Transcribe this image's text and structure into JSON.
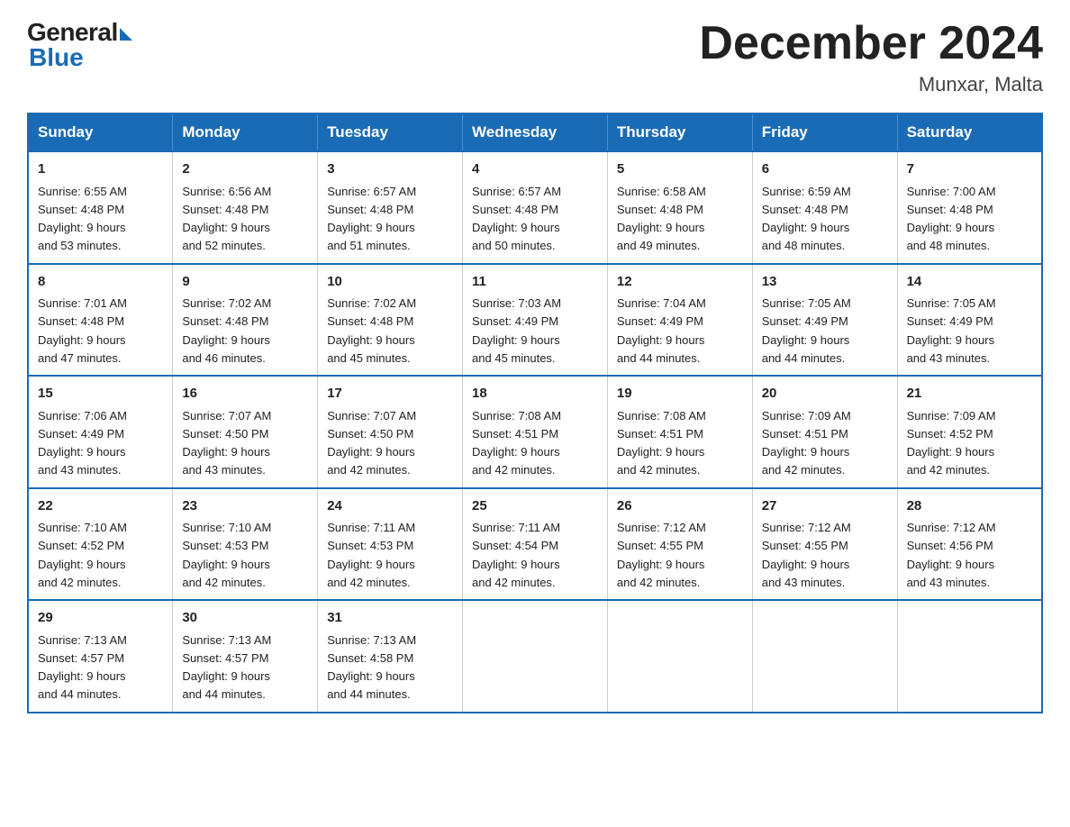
{
  "header": {
    "logo": {
      "general": "General",
      "blue": "Blue"
    },
    "title": "December 2024",
    "location": "Munxar, Malta"
  },
  "calendar": {
    "days_of_week": [
      "Sunday",
      "Monday",
      "Tuesday",
      "Wednesday",
      "Thursday",
      "Friday",
      "Saturday"
    ],
    "weeks": [
      [
        {
          "day": "1",
          "sunrise": "6:55 AM",
          "sunset": "4:48 PM",
          "daylight": "9 hours and 53 minutes."
        },
        {
          "day": "2",
          "sunrise": "6:56 AM",
          "sunset": "4:48 PM",
          "daylight": "9 hours and 52 minutes."
        },
        {
          "day": "3",
          "sunrise": "6:57 AM",
          "sunset": "4:48 PM",
          "daylight": "9 hours and 51 minutes."
        },
        {
          "day": "4",
          "sunrise": "6:57 AM",
          "sunset": "4:48 PM",
          "daylight": "9 hours and 50 minutes."
        },
        {
          "day": "5",
          "sunrise": "6:58 AM",
          "sunset": "4:48 PM",
          "daylight": "9 hours and 49 minutes."
        },
        {
          "day": "6",
          "sunrise": "6:59 AM",
          "sunset": "4:48 PM",
          "daylight": "9 hours and 48 minutes."
        },
        {
          "day": "7",
          "sunrise": "7:00 AM",
          "sunset": "4:48 PM",
          "daylight": "9 hours and 48 minutes."
        }
      ],
      [
        {
          "day": "8",
          "sunrise": "7:01 AM",
          "sunset": "4:48 PM",
          "daylight": "9 hours and 47 minutes."
        },
        {
          "day": "9",
          "sunrise": "7:02 AM",
          "sunset": "4:48 PM",
          "daylight": "9 hours and 46 minutes."
        },
        {
          "day": "10",
          "sunrise": "7:02 AM",
          "sunset": "4:48 PM",
          "daylight": "9 hours and 45 minutes."
        },
        {
          "day": "11",
          "sunrise": "7:03 AM",
          "sunset": "4:49 PM",
          "daylight": "9 hours and 45 minutes."
        },
        {
          "day": "12",
          "sunrise": "7:04 AM",
          "sunset": "4:49 PM",
          "daylight": "9 hours and 44 minutes."
        },
        {
          "day": "13",
          "sunrise": "7:05 AM",
          "sunset": "4:49 PM",
          "daylight": "9 hours and 44 minutes."
        },
        {
          "day": "14",
          "sunrise": "7:05 AM",
          "sunset": "4:49 PM",
          "daylight": "9 hours and 43 minutes."
        }
      ],
      [
        {
          "day": "15",
          "sunrise": "7:06 AM",
          "sunset": "4:49 PM",
          "daylight": "9 hours and 43 minutes."
        },
        {
          "day": "16",
          "sunrise": "7:07 AM",
          "sunset": "4:50 PM",
          "daylight": "9 hours and 43 minutes."
        },
        {
          "day": "17",
          "sunrise": "7:07 AM",
          "sunset": "4:50 PM",
          "daylight": "9 hours and 42 minutes."
        },
        {
          "day": "18",
          "sunrise": "7:08 AM",
          "sunset": "4:51 PM",
          "daylight": "9 hours and 42 minutes."
        },
        {
          "day": "19",
          "sunrise": "7:08 AM",
          "sunset": "4:51 PM",
          "daylight": "9 hours and 42 minutes."
        },
        {
          "day": "20",
          "sunrise": "7:09 AM",
          "sunset": "4:51 PM",
          "daylight": "9 hours and 42 minutes."
        },
        {
          "day": "21",
          "sunrise": "7:09 AM",
          "sunset": "4:52 PM",
          "daylight": "9 hours and 42 minutes."
        }
      ],
      [
        {
          "day": "22",
          "sunrise": "7:10 AM",
          "sunset": "4:52 PM",
          "daylight": "9 hours and 42 minutes."
        },
        {
          "day": "23",
          "sunrise": "7:10 AM",
          "sunset": "4:53 PM",
          "daylight": "9 hours and 42 minutes."
        },
        {
          "day": "24",
          "sunrise": "7:11 AM",
          "sunset": "4:53 PM",
          "daylight": "9 hours and 42 minutes."
        },
        {
          "day": "25",
          "sunrise": "7:11 AM",
          "sunset": "4:54 PM",
          "daylight": "9 hours and 42 minutes."
        },
        {
          "day": "26",
          "sunrise": "7:12 AM",
          "sunset": "4:55 PM",
          "daylight": "9 hours and 42 minutes."
        },
        {
          "day": "27",
          "sunrise": "7:12 AM",
          "sunset": "4:55 PM",
          "daylight": "9 hours and 43 minutes."
        },
        {
          "day": "28",
          "sunrise": "7:12 AM",
          "sunset": "4:56 PM",
          "daylight": "9 hours and 43 minutes."
        }
      ],
      [
        {
          "day": "29",
          "sunrise": "7:13 AM",
          "sunset": "4:57 PM",
          "daylight": "9 hours and 44 minutes."
        },
        {
          "day": "30",
          "sunrise": "7:13 AM",
          "sunset": "4:57 PM",
          "daylight": "9 hours and 44 minutes."
        },
        {
          "day": "31",
          "sunrise": "7:13 AM",
          "sunset": "4:58 PM",
          "daylight": "9 hours and 44 minutes."
        },
        null,
        null,
        null,
        null
      ]
    ],
    "labels": {
      "sunrise": "Sunrise: ",
      "sunset": "Sunset: ",
      "daylight": "Daylight: "
    }
  }
}
